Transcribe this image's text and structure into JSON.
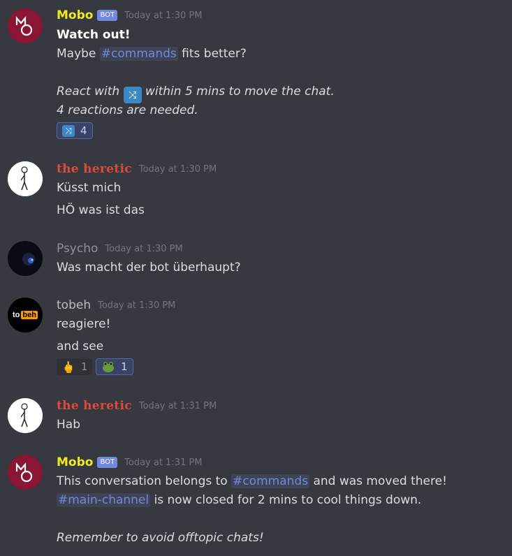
{
  "messages": [
    {
      "author": "Mobo",
      "bot_tag": "BOT",
      "time": "Today at 1:30 PM",
      "lines": {
        "title": "Watch out!",
        "maybe_pre": "Maybe",
        "maybe_channel": "#commands",
        "maybe_post": "fits better?",
        "react_pre": "React with",
        "react_post": "within 5 mins to move the chat.",
        "needed": "4 reactions are needed."
      },
      "reaction": {
        "emoji": "twisted-arrows-icon",
        "count": "4"
      }
    },
    {
      "author": "the heretic",
      "time": "Today at 1:30 PM",
      "lines": [
        "Küsst mich",
        "HÖ was ist das"
      ]
    },
    {
      "author": "Psycho",
      "time": "Today at 1:30 PM",
      "lines": [
        "Was macht der bot überhaupt?"
      ]
    },
    {
      "author": "tobeh",
      "time": "Today at 1:30 PM",
      "lines": [
        "reagiere!",
        "and see"
      ],
      "avatar_text": {
        "left": "to",
        "right": "beh"
      },
      "reactions": [
        {
          "emoji": "middle-finger-icon",
          "count": "1"
        },
        {
          "emoji": "frog-icon",
          "count": "1"
        }
      ]
    },
    {
      "author": "the heretic",
      "time": "Today at 1:31 PM",
      "lines": [
        "Hab"
      ]
    },
    {
      "author": "Mobo",
      "bot_tag": "BOT",
      "time": "Today at 1:31 PM",
      "lines": {
        "l1_pre": "This conversation belongs to",
        "l1_channel": "#commands",
        "l1_post": "and was moved there!",
        "l2_channel": "#main-channel",
        "l2_post": "is now closed for 2 mins to cool things down.",
        "l3": "Remember to avoid offtopic chats!"
      }
    }
  ],
  "colors": {
    "bg": "#36393f",
    "bot_name": "#f1e91f",
    "heretic_name": "#e04a3a",
    "mention": "#7289da",
    "bot_tag": "#7289da"
  }
}
